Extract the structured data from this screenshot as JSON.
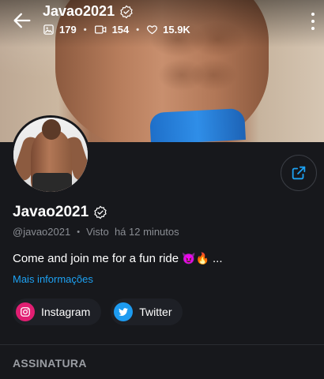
{
  "header": {
    "title": "Javao2021",
    "stats": {
      "photos": "179",
      "videos": "154",
      "likes": "15.9K"
    }
  },
  "profile": {
    "name": "Javao2021",
    "username": "@javao2021",
    "last_seen": "Visto  há 12 minutos",
    "bio": "Come and join me for a fun ride",
    "bio_emojis": "😈🔥",
    "bio_ellipsis": "...",
    "more_info_label": "Mais informações"
  },
  "social": [
    {
      "label": "Instagram",
      "icon": "instagram-icon"
    },
    {
      "label": "Twitter",
      "icon": "twitter-icon"
    }
  ],
  "section": {
    "title": "ASSINATURA"
  },
  "colors": {
    "background": "#17181c",
    "link": "#1da1f2",
    "instagram": "#e11e72",
    "twitter": "#1d9bf0"
  }
}
